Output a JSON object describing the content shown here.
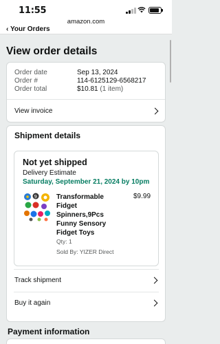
{
  "status_bar": {
    "time": "11:55",
    "icons": [
      "signal-icon",
      "wifi-icon",
      "battery-icon"
    ]
  },
  "browser": {
    "url": "amazon.com"
  },
  "nav": {
    "back_label": "Your Orders",
    "back_icon": "chevron-left-icon"
  },
  "page": {
    "title": "View order details"
  },
  "order_summary": {
    "rows": [
      {
        "label": "Order date",
        "value": "Sep 13, 2024"
      },
      {
        "label": "Order #",
        "value": "114-6125129-6568217"
      },
      {
        "label": "Order total",
        "value": "$10.81",
        "sub": "(1 item)"
      }
    ],
    "invoice_label": "View invoice"
  },
  "shipment": {
    "section_title": "Shipment details",
    "status": "Not yet shipped",
    "delivery_label": "Delivery Estimate",
    "delivery_date": "Saturday, September 21, 2024 by 10pm",
    "item": {
      "name": "Transformable Fidget Spinners,9Pcs Funny Sensory Fidget Toys",
      "price": "$9.99",
      "qty": "Qty: 1",
      "sold_by": "Sold By: YIZER Direct"
    },
    "actions": [
      "Track shipment",
      "Buy it again"
    ]
  },
  "payment": {
    "section_title": "Payment information"
  },
  "colors": {
    "accent_green": "#067d62",
    "background": "#eaeded",
    "card": "#ffffff"
  }
}
